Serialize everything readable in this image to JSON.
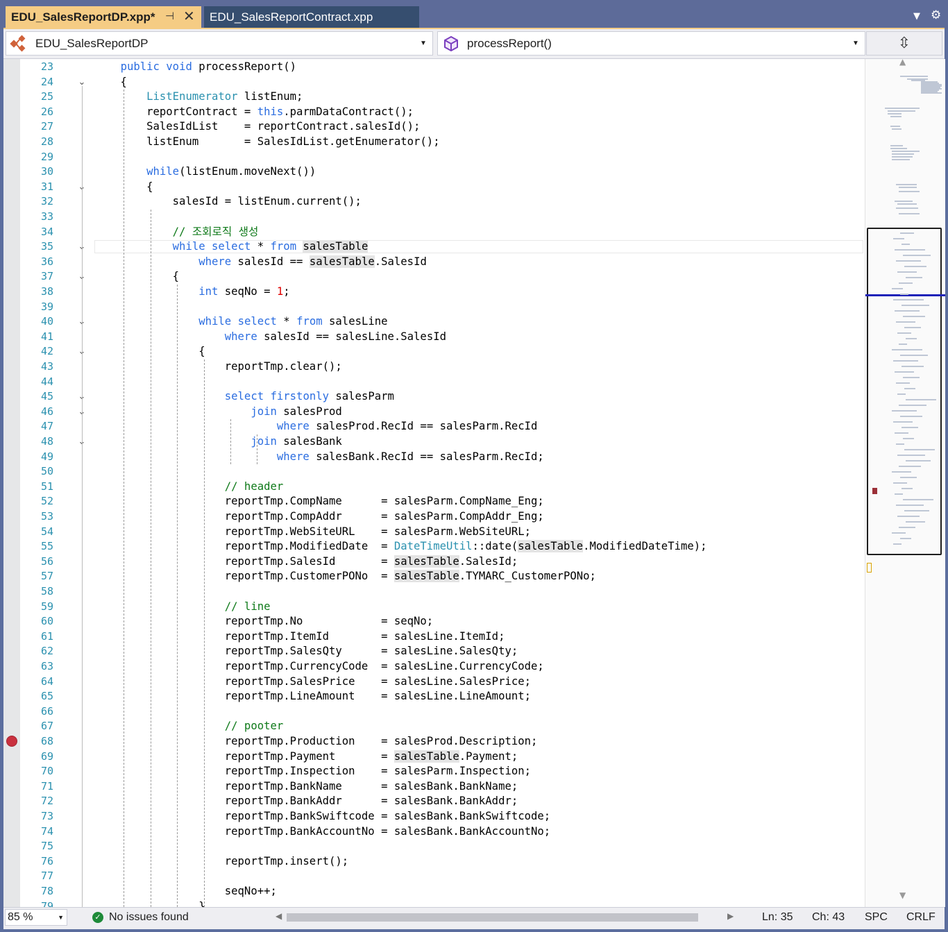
{
  "tabs": [
    {
      "label": "EDU_SalesReportDP.xpp*",
      "active": true
    },
    {
      "label": "EDU_SalesReportContract.xpp",
      "active": false
    }
  ],
  "nav": {
    "class_combo": "EDU_SalesReportDP",
    "method_combo": "processReport()",
    "class_icon": "class-icon",
    "method_icon": "method-cube-icon"
  },
  "editor": {
    "current_line": 35,
    "lines": [
      {
        "n": "23",
        "t": "    public void processReport()",
        "html": "    <span class=\"kw\">public</span> <span class=\"kw\">void</span> processReport()"
      },
      {
        "n": "24",
        "t": "    {"
      },
      {
        "n": "25",
        "t": "        ListEnumerator listEnum;",
        "html": "        <span class=\"ty\">ListEnumerator</span> listEnum;"
      },
      {
        "n": "26",
        "t": "        reportContract = this.parmDataContract();",
        "html": "        reportContract = <span class=\"kw\">this</span>.parmDataContract();"
      },
      {
        "n": "27",
        "t": "        SalesIdList    = reportContract.salesId();"
      },
      {
        "n": "28",
        "t": "        listEnum       = SalesIdList.getEnumerator();"
      },
      {
        "n": "29",
        "t": ""
      },
      {
        "n": "30",
        "t": "        while(listEnum.moveNext())",
        "html": "        <span class=\"kw\">while</span>(listEnum.moveNext())"
      },
      {
        "n": "31",
        "t": "        {"
      },
      {
        "n": "32",
        "t": "            salesId = listEnum.current();"
      },
      {
        "n": "33",
        "t": ""
      },
      {
        "n": "34",
        "t": "            // 조회로직 생성",
        "html": "            <span class=\"cm\">// 조회로직 생성</span>"
      },
      {
        "n": "35",
        "t": "            while select * from salesTable",
        "html": "            <span class=\"kw\">while</span> <span class=\"kw\">select</span> * <span class=\"kw\">from</span> <span class=\"ref\">salesTable</span>"
      },
      {
        "n": "36",
        "t": "                where salesId == salesTable.SalesId",
        "html": "                <span class=\"kw\">where</span> salesId == <span class=\"ref\">salesTable</span>.SalesId"
      },
      {
        "n": "37",
        "t": "            {"
      },
      {
        "n": "38",
        "t": "                int seqNo = 1;",
        "html": "                <span class=\"kw\">int</span> seqNo = <span class=\"num\">1</span>;"
      },
      {
        "n": "39",
        "t": ""
      },
      {
        "n": "40",
        "t": "                while select * from salesLine",
        "html": "                <span class=\"kw\">while</span> <span class=\"kw\">select</span> * <span class=\"kw\">from</span> salesLine"
      },
      {
        "n": "41",
        "t": "                    where salesId == salesLine.SalesId",
        "html": "                    <span class=\"kw\">where</span> salesId == salesLine.SalesId"
      },
      {
        "n": "42",
        "t": "                {"
      },
      {
        "n": "43",
        "t": "                    reportTmp.clear();"
      },
      {
        "n": "44",
        "t": ""
      },
      {
        "n": "45",
        "t": "                    select firstonly salesParm",
        "html": "                    <span class=\"kw\">select</span> <span class=\"kw\">firstonly</span> salesParm"
      },
      {
        "n": "46",
        "t": "                        join salesProd",
        "html": "                        <span class=\"kw\">join</span> salesProd"
      },
      {
        "n": "47",
        "t": "                            where salesProd.RecId == salesParm.RecId",
        "html": "                            <span class=\"kw\">where</span> salesProd.RecId == salesParm.RecId"
      },
      {
        "n": "48",
        "t": "                        join salesBank",
        "html": "                        <span class=\"kw\">join</span> salesBank"
      },
      {
        "n": "49",
        "t": "                            where salesBank.RecId == salesParm.RecId;",
        "html": "                            <span class=\"kw\">where</span> salesBank.RecId == salesParm.RecId;"
      },
      {
        "n": "50",
        "t": ""
      },
      {
        "n": "51",
        "t": "                    // header",
        "html": "                    <span class=\"cm\">// header</span>"
      },
      {
        "n": "52",
        "t": "                    reportTmp.CompName      = salesParm.CompName_Eng;"
      },
      {
        "n": "53",
        "t": "                    reportTmp.CompAddr      = salesParm.CompAddr_Eng;"
      },
      {
        "n": "54",
        "t": "                    reportTmp.WebSiteURL    = salesParm.WebSiteURL;"
      },
      {
        "n": "55",
        "t": "                    reportTmp.ModifiedDate  = DateTimeUtil::date(salesTable.ModifiedDateTime);",
        "html": "                    reportTmp.ModifiedDate  = <span class=\"ty\">DateTimeUtil</span>::date(<span class=\"ref\">salesTable</span>.ModifiedDateTime);"
      },
      {
        "n": "56",
        "t": "                    reportTmp.SalesId       = salesTable.SalesId;",
        "html": "                    reportTmp.SalesId       = <span class=\"ref\">salesTable</span>.SalesId;"
      },
      {
        "n": "57",
        "t": "                    reportTmp.CustomerPONo  = salesTable.TYMARC_CustomerPONo;",
        "html": "                    reportTmp.CustomerPONo  = <span class=\"ref\">salesTable</span>.TYMARC_CustomerPONo;"
      },
      {
        "n": "58",
        "t": ""
      },
      {
        "n": "59",
        "t": "                    // line",
        "html": "                    <span class=\"cm\">// line</span>"
      },
      {
        "n": "60",
        "t": "                    reportTmp.No            = seqNo;"
      },
      {
        "n": "61",
        "t": "                    reportTmp.ItemId        = salesLine.ItemId;"
      },
      {
        "n": "62",
        "t": "                    reportTmp.SalesQty      = salesLine.SalesQty;"
      },
      {
        "n": "63",
        "t": "                    reportTmp.CurrencyCode  = salesLine.CurrencyCode;"
      },
      {
        "n": "64",
        "t": "                    reportTmp.SalesPrice    = salesLine.SalesPrice;"
      },
      {
        "n": "65",
        "t": "                    reportTmp.LineAmount    = salesLine.LineAmount;"
      },
      {
        "n": "66",
        "t": ""
      },
      {
        "n": "67",
        "t": "                    // pooter",
        "html": "                    <span class=\"cm\">// pooter</span>"
      },
      {
        "n": "68",
        "t": "                    reportTmp.Production    = salesProd.Description;",
        "breakpoint": true
      },
      {
        "n": "69",
        "t": "                    reportTmp.Payment       = salesTable.Payment;",
        "html": "                    reportTmp.Payment       = <span class=\"ref\">salesTable</span>.Payment;"
      },
      {
        "n": "70",
        "t": "                    reportTmp.Inspection    = salesParm.Inspection;"
      },
      {
        "n": "71",
        "t": "                    reportTmp.BankName      = salesBank.BankName;"
      },
      {
        "n": "72",
        "t": "                    reportTmp.BankAddr      = salesBank.BankAddr;"
      },
      {
        "n": "73",
        "t": "                    reportTmp.BankSwiftcode = salesBank.BankSwiftcode;"
      },
      {
        "n": "74",
        "t": "                    reportTmp.BankAccountNo = salesBank.BankAccountNo;"
      },
      {
        "n": "75",
        "t": ""
      },
      {
        "n": "76",
        "t": "                    reportTmp.insert();"
      },
      {
        "n": "77",
        "t": ""
      },
      {
        "n": "78",
        "t": "                    seqNo++;"
      },
      {
        "n": "79",
        "t": "                }"
      }
    ],
    "fold_lines": [
      "24",
      "31",
      "35",
      "37",
      "40",
      "42",
      "45",
      "46",
      "48"
    ]
  },
  "status": {
    "zoom": "85 %",
    "issues": "No issues found",
    "ln": "Ln: 35",
    "ch": "Ch: 43",
    "spc": "SPC",
    "crlf": "CRLF"
  },
  "colors": {
    "keyword": "#2b6de0",
    "type": "#2b91af",
    "comment": "#0f7a1a",
    "number": "#e00000",
    "active_tab": "#f5cc84",
    "breakpoint": "#c9313f"
  }
}
